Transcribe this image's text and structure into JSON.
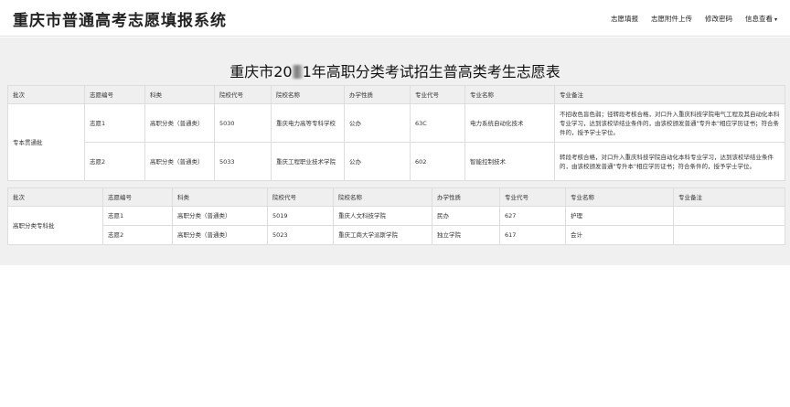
{
  "app": {
    "title": "重庆市普通高考志愿填报系统"
  },
  "nav": {
    "items": [
      "志愿填报",
      "志愿附件上传",
      "修改密码",
      "信息查看"
    ],
    "caret": "▾"
  },
  "page": {
    "title_prefix": "重庆市20",
    "title_suffix": "1年高职分类考试招生普高类考生志愿表"
  },
  "table1": {
    "headers": [
      "批次",
      "志愿编号",
      "科类",
      "院校代号",
      "院校名称",
      "办学性质",
      "专业代号",
      "专业名称",
      "专业备注"
    ],
    "batch": "专本贯通批",
    "rows": [
      {
        "no": "志愿1",
        "category": "高职分类（普通类）",
        "school_code": "5030",
        "school_name": "重庆电力高等专科学校",
        "nature": "公办",
        "major_code": "63C",
        "major_name": "电力系统自动化技术",
        "remark": "不招收色盲色弱；径转段考核合格，对口升入重庆科技学院电气工程及其自动化本科专业学习，达到该校毕结业条件的，由该校颁发普通\"专升本\"相应学历证书；符合条件的，授予学士学位。"
      },
      {
        "no": "志愿2",
        "category": "高职分类（普通类）",
        "school_code": "5033",
        "school_name": "重庆工程职业技术学院",
        "nature": "公办",
        "major_code": "602",
        "major_name": "智能控制技术",
        "remark": "转段考核合格，对口升入重庆科技学院自动化本科专业学习，达到该校毕结业条件的，由该校颁发普通\"专升本\"相应学历证书；符合条件的，授予学士学位。"
      }
    ]
  },
  "table2": {
    "headers": [
      "批次",
      "志愿编号",
      "科类",
      "院校代号",
      "院校名称",
      "办学性质",
      "专业代号",
      "专业名称",
      "专业备注"
    ],
    "batch": "高职分类专科批",
    "rows": [
      {
        "no": "志愿1",
        "category": "高职分类（普通类）",
        "school_code": "5019",
        "school_name": "重庆人文科技学院",
        "nature": "民办",
        "major_code": "627",
        "major_name": "护理",
        "remark": ""
      },
      {
        "no": "志愿2",
        "category": "高职分类（普通类）",
        "school_code": "5023",
        "school_name": "重庆工商大学派斯学院",
        "nature": "独立学院",
        "major_code": "617",
        "major_name": "会计",
        "remark": ""
      }
    ]
  }
}
